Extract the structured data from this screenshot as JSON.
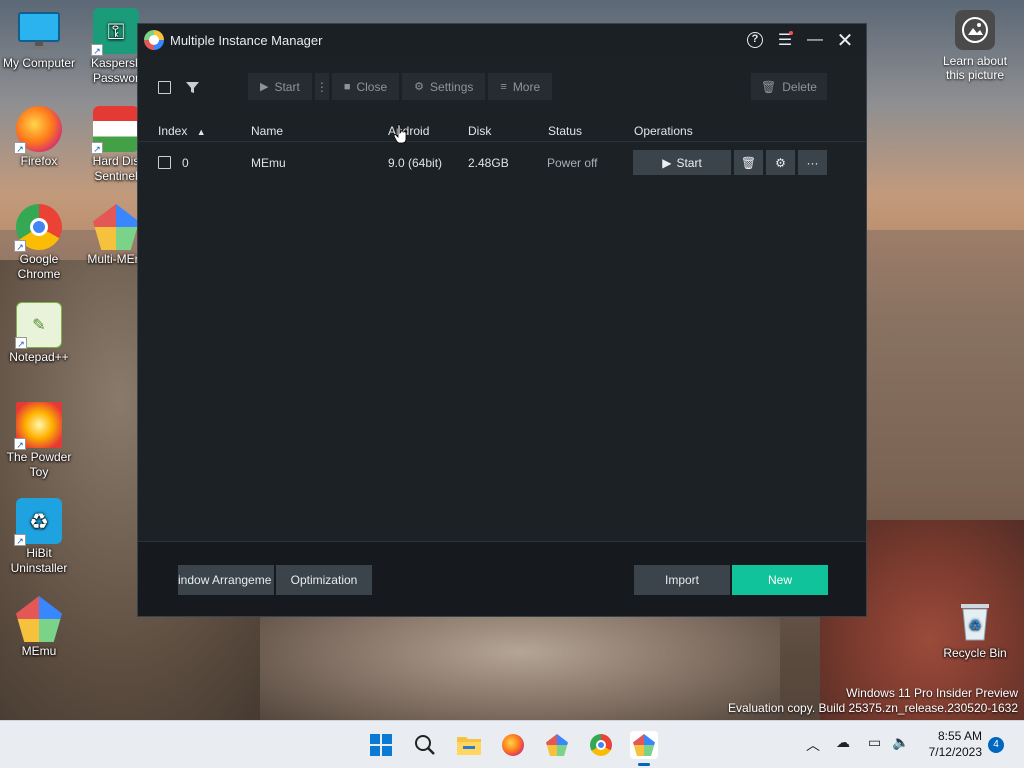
{
  "desktop": {
    "icons": [
      {
        "label": "My Computer"
      },
      {
        "label": "Kaspersk\nPasswor"
      },
      {
        "label": "Firefox"
      },
      {
        "label": "Hard Dis\nSentinel"
      },
      {
        "label": "Google\nChrome"
      },
      {
        "label": "Multi-MEm"
      },
      {
        "label": "Notepad++"
      },
      {
        "label": "The Powder\nToy"
      },
      {
        "label": "HiBit\nUninstaller"
      },
      {
        "label": "MEmu"
      },
      {
        "label": "Recycle Bin"
      }
    ],
    "learn_label": "Learn about this picture",
    "watermark_line1": "Windows 11 Pro Insider Preview",
    "watermark_line2": "Evaluation copy. Build 25375.zn_release.230520-1632"
  },
  "window": {
    "title": "Multiple Instance Manager",
    "toolbar": {
      "start": "Start",
      "close": "Close",
      "settings": "Settings",
      "more": "More",
      "delete": "Delete"
    },
    "columns": {
      "index": "Index",
      "name": "Name",
      "android": "Android",
      "disk": "Disk",
      "status": "Status",
      "operations": "Operations"
    },
    "rows": [
      {
        "index": "0",
        "name": "MEmu",
        "android": "9.0 (64bit)",
        "disk": "2.48GB",
        "status": "Power off",
        "start_label": "Start"
      }
    ],
    "footer": {
      "window_arrangement": "indow Arrangeme",
      "optimization": "Optimization",
      "import": "Import",
      "new": "New"
    }
  },
  "taskbar": {
    "time": "8:55 AM",
    "date": "7/12/2023",
    "notification_count": "4"
  },
  "colors": {
    "accent": "#11c39a",
    "window_bg": "#1c2126",
    "button_bg": "#3b434b"
  }
}
